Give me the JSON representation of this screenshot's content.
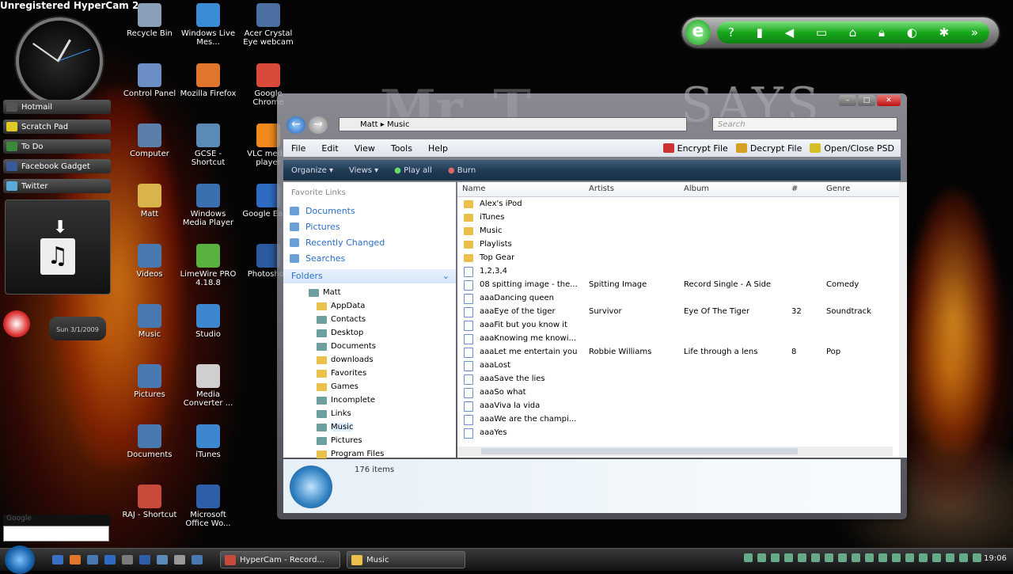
{
  "watermark": "Unregistered HyperCam 2",
  "wallpaper_text": {
    "says": "SAYS",
    "mrt": "Mr. T"
  },
  "sidebar": {
    "bars": [
      {
        "label": "Hotmail",
        "color": "#555555"
      },
      {
        "label": "Scratch Pad",
        "color": "#e2c92a"
      },
      {
        "label": "To Do",
        "color": "#3b8a3b"
      },
      {
        "label": "Facebook Gadget",
        "color": "#3b5998"
      },
      {
        "label": "Twitter",
        "color": "#59a9d9"
      }
    ],
    "stopwatch_label": "Sun 3/1/2009",
    "search_label": "Google"
  },
  "desktop_icons": [
    {
      "label": "Recycle Bin",
      "color": "#8aa0b8"
    },
    {
      "label": "Windows Live Mes...",
      "color": "#3a8cd6"
    },
    {
      "label": "Acer Crystal Eye webcam",
      "color": "#4a6fa0"
    },
    {
      "label": "Control Panel",
      "color": "#6b8fc4"
    },
    {
      "label": "Mozilla Firefox",
      "color": "#e0752c"
    },
    {
      "label": "Google Chrome",
      "color": "#d94a3a"
    },
    {
      "label": "Computer",
      "color": "#5b7fa8"
    },
    {
      "label": "GCSE - Shortcut",
      "color": "#5a8ab5"
    },
    {
      "label": "VLC media player",
      "color": "#f08a1c"
    },
    {
      "label": "Matt",
      "color": "#d9b44a"
    },
    {
      "label": "Windows Media Player",
      "color": "#3a6fb0"
    },
    {
      "label": "Google Earth",
      "color": "#2e6cc2"
    },
    {
      "label": "Videos",
      "color": "#4a78b0"
    },
    {
      "label": "LimeWire PRO 4.18.8",
      "color": "#59b13f"
    },
    {
      "label": "Photoshop",
      "color": "#2c5aa0"
    },
    {
      "label": "Music",
      "color": "#4a78b0"
    },
    {
      "label": "Studio",
      "color": "#3d86d0"
    },
    {
      "label": "Pictures",
      "color": "#4a78b0"
    },
    {
      "label": "Media Converter ...",
      "color": "#cfcfcf"
    },
    {
      "label": "Documents",
      "color": "#4a78b0"
    },
    {
      "label": "iTunes",
      "color": "#3d86d0"
    },
    {
      "label": "RAJ - Shortcut",
      "color": "#c84a3a"
    },
    {
      "label": "Microsoft Office Wo...",
      "color": "#2f5ea8"
    }
  ],
  "explorer": {
    "breadcrumb": [
      "Matt",
      "Music"
    ],
    "search_placeholder": "Search",
    "menu": [
      "File",
      "Edit",
      "View",
      "Tools",
      "Help"
    ],
    "menu_right": [
      {
        "label": "Encrypt File",
        "color": "#cc3333"
      },
      {
        "label": "Decrypt File",
        "color": "#d4a024"
      },
      {
        "label": "Open/Close PSD",
        "color": "#d4c024"
      }
    ],
    "commands": [
      "Organize",
      "Views",
      "Play all",
      "Burn"
    ],
    "favorites_title": "Favorite Links",
    "favorites": [
      "Documents",
      "Pictures",
      "Recently Changed",
      "Searches"
    ],
    "folders_title": "Folders",
    "tree": [
      {
        "label": "Matt",
        "sys": true
      },
      {
        "label": "AppData",
        "sys": false
      },
      {
        "label": "Contacts",
        "sys": true
      },
      {
        "label": "Desktop",
        "sys": true
      },
      {
        "label": "Documents",
        "sys": true
      },
      {
        "label": "downloads",
        "sys": false
      },
      {
        "label": "Favorites",
        "sys": false
      },
      {
        "label": "Games",
        "sys": false
      },
      {
        "label": "Incomplete",
        "sys": true
      },
      {
        "label": "Links",
        "sys": true
      },
      {
        "label": "Music",
        "sys": true,
        "selected": true
      },
      {
        "label": "Pictures",
        "sys": true
      },
      {
        "label": "Program Files",
        "sys": false
      }
    ],
    "columns": [
      "Name",
      "Artists",
      "Album",
      "#",
      "Genre"
    ],
    "rows": [
      {
        "name": "Alex's iPod",
        "folder": true
      },
      {
        "name": "iTunes",
        "folder": true
      },
      {
        "name": "Music",
        "folder": true
      },
      {
        "name": "Playlists",
        "folder": true
      },
      {
        "name": "Top Gear",
        "folder": true
      },
      {
        "name": "1,2,3,4",
        "folder": false
      },
      {
        "name": "08 spitting image - the...",
        "artist": "Spitting Image",
        "album": "Record Single - A Side",
        "num": "",
        "genre": "Comedy"
      },
      {
        "name": "aaaDancing queen"
      },
      {
        "name": "aaaEye of the tiger",
        "artist": "Survivor",
        "album": "Eye Of The Tiger",
        "num": "32",
        "genre": "Soundtrack"
      },
      {
        "name": "aaaFit but you know it"
      },
      {
        "name": "aaaKnowing me knowi..."
      },
      {
        "name": "aaaLet me entertain you",
        "artist": "Robbie Williams",
        "album": "Life through a lens",
        "num": "8",
        "genre": "Pop"
      },
      {
        "name": "aaaLost"
      },
      {
        "name": "aaaSave the lies"
      },
      {
        "name": "aaaSo what"
      },
      {
        "name": "aaaViva la vida"
      },
      {
        "name": "aaaWe are the champi..."
      },
      {
        "name": "aaaYes"
      }
    ],
    "status_count": "176 items"
  },
  "taskbar": {
    "tasks": [
      "HyperCam - Record...",
      "Music"
    ],
    "clock": "19:06"
  }
}
